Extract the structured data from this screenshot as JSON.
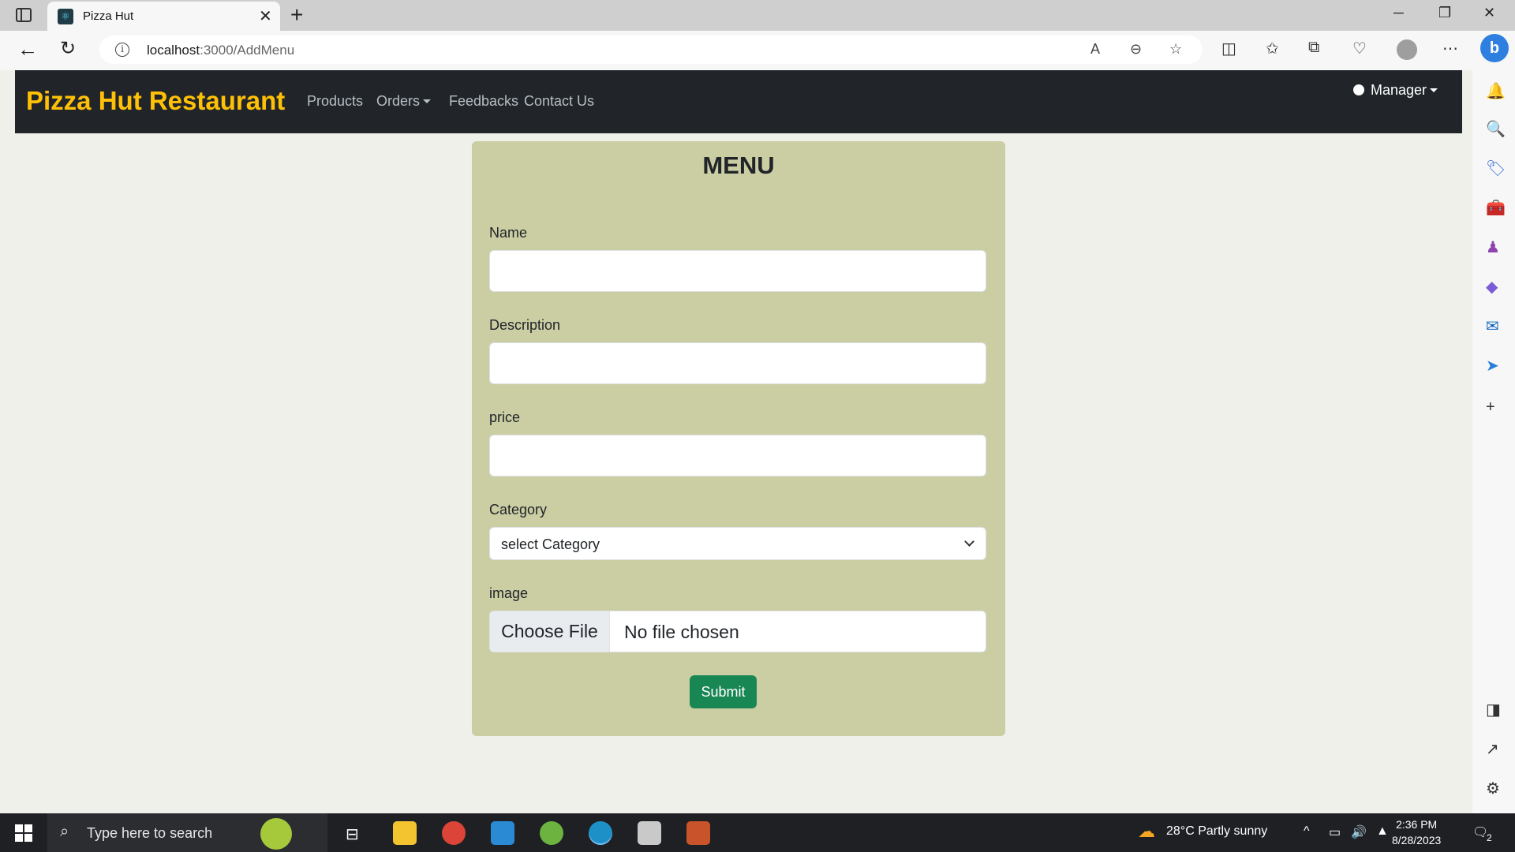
{
  "browser": {
    "tab_title": "Pizza Hut",
    "url_host": "localhost",
    "url_path": ":3000/AddMenu"
  },
  "navbar": {
    "brand": "Pizza Hut Restaurant",
    "links": [
      "Products",
      "Orders",
      "Feedbacks",
      "Contact Us"
    ],
    "user_menu": "Manager"
  },
  "form": {
    "title": "MENU",
    "name_label": "Name",
    "name_value": "",
    "description_label": "Description",
    "description_value": "",
    "price_label": "price",
    "price_value": "",
    "category_label": "Category",
    "category_selected": "select Category",
    "image_label": "image",
    "file_button": "Choose File",
    "file_status": "No file chosen",
    "submit_label": "Submit"
  },
  "taskbar": {
    "search_placeholder": "Type here to search",
    "weather": "28°C  Partly sunny",
    "time": "2:36 PM",
    "date": "8/28/2023",
    "notification_count": "2"
  },
  "colors": {
    "brand": "#ffc107",
    "navbar_bg": "#21252a",
    "card_bg": "#cbcea3",
    "submit_bg": "#198754",
    "page_bg": "#f0f0ea"
  }
}
